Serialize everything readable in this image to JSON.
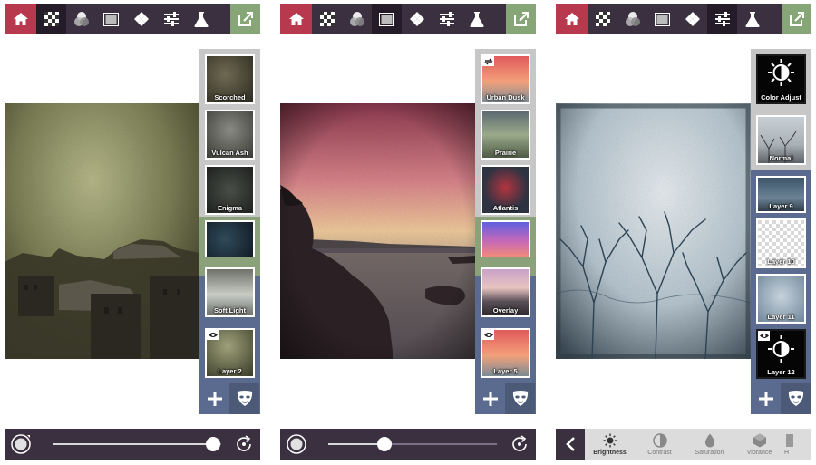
{
  "toolbar": {
    "buttons": [
      "home-icon",
      "texture-icon",
      "blend-icon",
      "frame-icon",
      "overlay-icon",
      "adjust-icon",
      "lab-icon",
      "export-icon"
    ]
  },
  "screens": [
    {
      "panel_layers": [
        "Scorched",
        "Vulcan Ash",
        "Enigma",
        "",
        "Soft Light",
        "Layer 2"
      ],
      "slider": {
        "value": 0.97
      }
    },
    {
      "panel_layers": [
        "Urban Dusk",
        "Prairie",
        "Atlantis",
        "",
        "Overlay",
        "Layer 5"
      ],
      "slider": {
        "value": 0.35
      }
    },
    {
      "panel_layers": [
        "Color Adjust",
        "Normal",
        "Layer 9",
        "Layer 10",
        "Layer 11",
        "Layer 12"
      ],
      "adjustments": [
        "Brightness",
        "Contrast",
        "Saturation",
        "Vibrance"
      ]
    }
  ],
  "colors": {
    "home": "#b8394d",
    "toolbar": "#3b3040",
    "export": "#86a677",
    "panel_gray": "#c7c7c7",
    "panel_green": "#8aa17a",
    "panel_blue": "#5b6b8f"
  }
}
